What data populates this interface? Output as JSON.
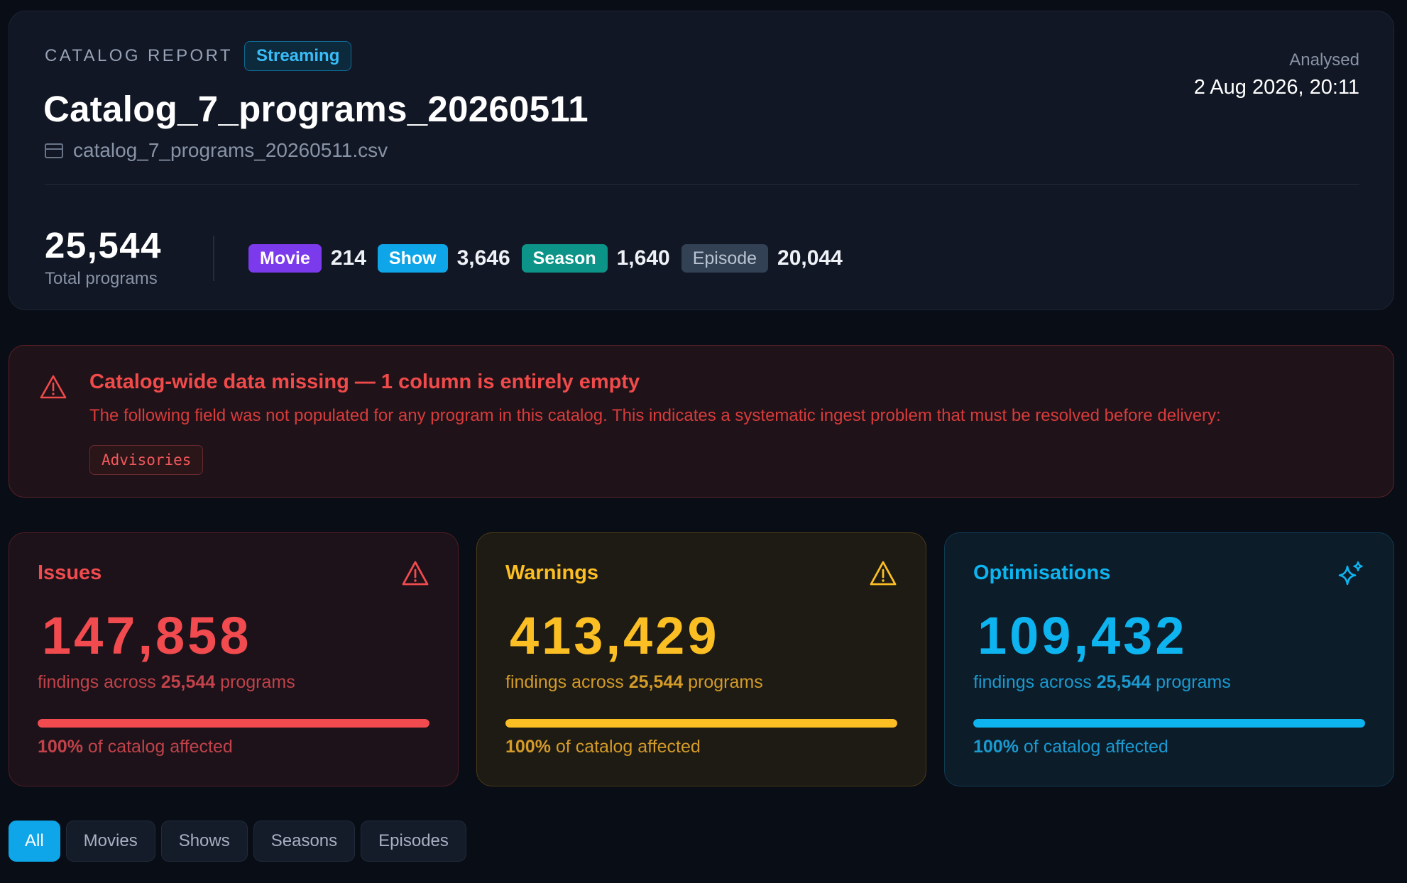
{
  "header": {
    "eyebrow": "CATALOG REPORT",
    "badge": "Streaming",
    "title": "Catalog_7_programs_20260511",
    "file_name": "catalog_7_programs_20260511.csv",
    "file_icon": "file-icon",
    "analysed_label": "Analysed",
    "analysed_value": "2 Aug 2026, 20:11"
  },
  "summary": {
    "total_value": "25,544",
    "total_label": "Total programs",
    "types": [
      {
        "label": "Movie",
        "count": "214",
        "color": "#7c3aed"
      },
      {
        "label": "Show",
        "count": "3,646",
        "color": "#0ea5e9"
      },
      {
        "label": "Season",
        "count": "1,640",
        "color": "#0d9488"
      },
      {
        "label": "Episode",
        "count": "20,044",
        "color": "#334155"
      }
    ]
  },
  "alert": {
    "icon": "warning-triangle-icon",
    "title": "Catalog-wide data missing — 1 column is entirely empty",
    "description": "The following field was not populated for any program in this catalog. This indicates a systematic ingest problem that must be resolved before delivery:",
    "columns": [
      "Advisories"
    ],
    "color": "#f04a4a"
  },
  "stats": {
    "issues": {
      "title": "Issues",
      "icon": "warning-triangle-icon",
      "value": "147,858",
      "sub_prefix": "findings across ",
      "sub_count": "25,544",
      "sub_suffix": " programs",
      "percent": "100%",
      "percent_value": 1.0,
      "foot_suffix": " of catalog affected",
      "color": "#f14b4f"
    },
    "warnings": {
      "title": "Warnings",
      "icon": "warning-triangle-icon",
      "value": "413,429",
      "sub_prefix": "findings across ",
      "sub_count": "25,544",
      "sub_suffix": " programs",
      "percent": "100%",
      "percent_value": 1.0,
      "foot_suffix": " of catalog affected",
      "color": "#fbbf24"
    },
    "optimisations": {
      "title": "Optimisations",
      "icon": "sparkles-icon",
      "value": "109,432",
      "sub_prefix": "findings across ",
      "sub_count": "25,544",
      "sub_suffix": " programs",
      "percent": "100%",
      "percent_value": 1.0,
      "foot_suffix": " of catalog affected",
      "color": "#0eb4ef"
    }
  },
  "tabs": {
    "active": "All",
    "items": [
      "All",
      "Movies",
      "Shows",
      "Seasons",
      "Episodes"
    ]
  }
}
